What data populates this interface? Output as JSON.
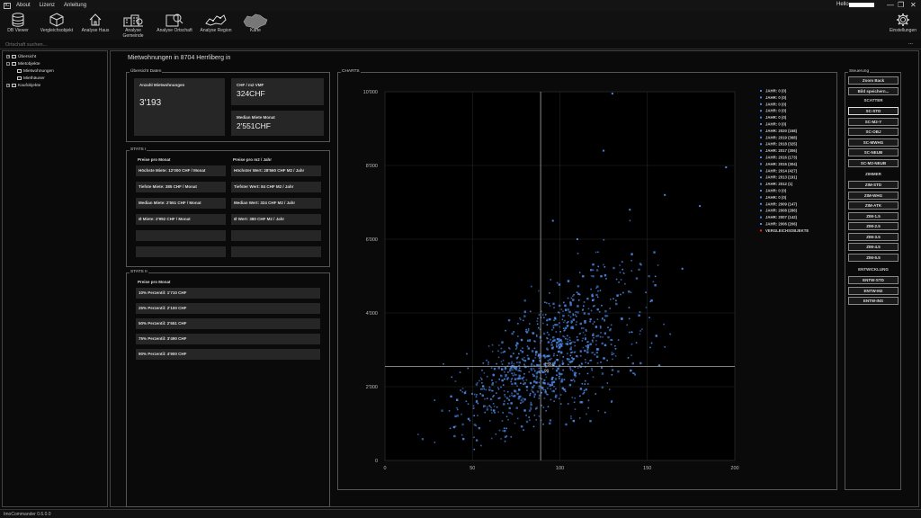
{
  "titlebar": {
    "app_icon": "IC",
    "menus": [
      "About",
      "Lizenz",
      "Anleitung"
    ],
    "hello": "Hello",
    "minimize": "—",
    "restore": "❐",
    "close": "✕"
  },
  "toolbar": {
    "items": [
      {
        "label": "DB Viewer",
        "icon": "database-icon"
      },
      {
        "label": "Vergleichsobjekt",
        "icon": "cube-icon"
      },
      {
        "label": "Analyse Haus",
        "icon": "house-icon"
      },
      {
        "label": "Analyse Gemeinde",
        "icon": "buildings-icon"
      },
      {
        "label": "Analyse Ortschaft",
        "icon": "map-search-icon"
      },
      {
        "label": "Analyse Region",
        "icon": "region-map-icon"
      },
      {
        "label": "Karte",
        "icon": "swiss-map-icon"
      }
    ],
    "settings_label": "Einstellungen"
  },
  "search": {
    "placeholder": "Ortschaft suchen...",
    "more": "..."
  },
  "tree": {
    "items": [
      {
        "label": "Übersicht",
        "level": 0,
        "toggle": "+"
      },
      {
        "label": "Mietobjekte",
        "level": 0,
        "toggle": "-"
      },
      {
        "label": "Mietwohnungen",
        "level": 1,
        "toggle": ""
      },
      {
        "label": "Miethäuser",
        "level": 1,
        "toggle": ""
      },
      {
        "label": "Kaufobjekte",
        "level": 0,
        "toggle": "+"
      }
    ]
  },
  "page": {
    "title": "Mietwohnungen in 8704 Herrliberg in"
  },
  "overview": {
    "title": "Übersicht Daten",
    "count_label": "Anzahl Mietwohnungen",
    "count_value": "3'193",
    "chf_m2_label": "CHF / m2 VMF",
    "chf_m2_value": "324CHF",
    "median_label": "Median Miete Monat",
    "median_value": "2'551CHF"
  },
  "stats1": {
    "title": "STATS I",
    "head_left": "Preise pro Monat",
    "head_right": "Preise pro m2 / Jahr",
    "left": [
      "Höchste Miete: 12'000 CHF / Monat",
      "Tiefste Miete: 385 CHF / Monat",
      "Median Miete: 2'551 CHF / Monat",
      "Ø Miete: 2'992 CHF / Monat",
      "",
      ""
    ],
    "right": [
      "Höchster Wert: 28'560 CHF M2 / Jahr",
      "Tiefster Wert: 84 CHF M2 / Jahr",
      "Median Wert: 324 CHF M2 / Jahr",
      "Ø Wert: 380 CHF M2 / Jahr",
      "",
      ""
    ]
  },
  "stats2": {
    "title": "STATS II",
    "head": "Preise pro Monat",
    "rows": [
      "10% Perzentil: 1'710 CHF",
      "25% Perzentil: 2'100 CHF",
      "50% Perzentil: 2'551 CHF",
      "75% Perzentil: 3'490 CHF",
      "90% Perzentil: 4'900 CHF"
    ]
  },
  "charts": {
    "title": "CHARTS"
  },
  "chart_data": {
    "type": "scatter",
    "xlim": [
      0,
      200
    ],
    "ylim": [
      0,
      10000
    ],
    "x_ticks": [
      0,
      50,
      100,
      150,
      200
    ],
    "y_ticks": [
      0,
      2000,
      4000,
      6000,
      8000,
      10000
    ],
    "x_tick_labels": [
      "0",
      "50",
      "100",
      "150",
      "200"
    ],
    "y_tick_labels": [
      "0",
      "2'000",
      "4'000",
      "6'000",
      "8'000",
      "10'000"
    ],
    "grid": true,
    "point_color": "#4b86e0",
    "crosshair": {
      "x": 89,
      "y": 2551,
      "label_y": "2'551",
      "label_x": "90"
    },
    "legend_position": "right",
    "legend": [
      "JAHR: 0 (0)",
      "JAHR: 0 (0)",
      "JAHR: 0 (0)",
      "JAHR: 0 (0)",
      "JAHR: 0 (0)",
      "JAHR: 0 (0)",
      "JAHR: 2020 (158)",
      "JAHR: 2019 (368)",
      "JAHR: 2018 (325)",
      "JAHR: 2017 (306)",
      "JAHR: 2016 (173)",
      "JAHR: 2015 (304)",
      "JAHR: 2014 (427)",
      "JAHR: 2013 (191)",
      "JAHR: 2012 (1)",
      "JAHR: 0 (0)",
      "JAHR: 0 (0)",
      "JAHR: 2009 (147)",
      "JAHR: 2008 (286)",
      "JAHR: 2007 (142)",
      "JAHR: 2006 (206)",
      "VERGLEICHSOBJEKTE"
    ],
    "highlight_legend_color": "#e03030"
  },
  "controls": {
    "title": "Steuerung",
    "zoom_back": "Zoom Back",
    "save_image": "Bild speichern...",
    "scatter_head": "SCATTER",
    "scatter": [
      "SC-STD",
      "SC-M2-Y",
      "SC-OBJ",
      "SC-MWHG",
      "SC-NEUB",
      "SC-M2-NEUB"
    ],
    "zimmer_head": "ZIMMER",
    "zimmer": [
      "ZIM-STD",
      "ZIM-WHG",
      "ZIM-ATK",
      "ZIM-1.5",
      "ZIM-2.5",
      "ZIM-3.5",
      "ZIM-4.5",
      "ZIM-5.5"
    ],
    "entw_head": "ENTWICKLUNG",
    "entw": [
      "ENTW-STD",
      "ENTW-M2",
      "ENTW-INS"
    ]
  },
  "status": {
    "text": "ImoCommander 0.6.0.0"
  }
}
